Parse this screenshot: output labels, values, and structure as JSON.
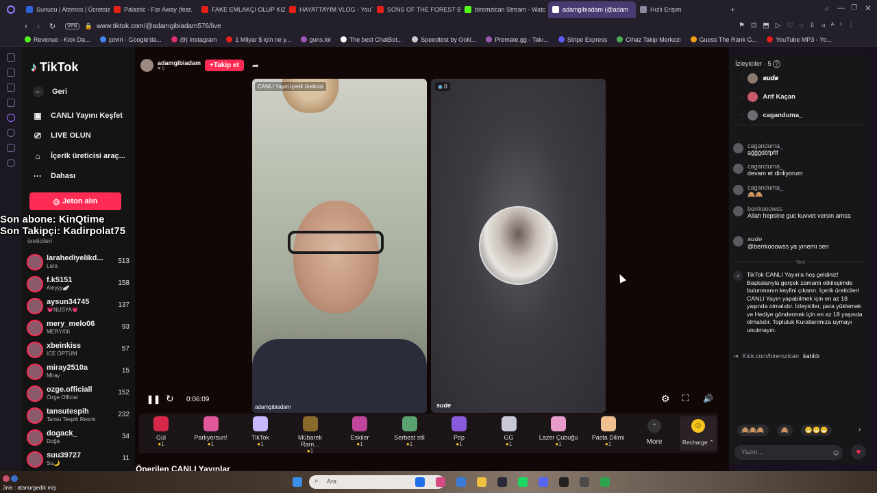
{
  "browser": {
    "tabs": [
      {
        "label": "Sunucu | Aternos | Ücretsiz",
        "color": "#2b62d6"
      },
      {
        "label": "Palastic - Far Away (feat.",
        "color": "#e62117"
      },
      {
        "label": "FAKE EMLAKÇI OLUP KIZ",
        "color": "#e62117"
      },
      {
        "label": "HAYATTAYIM VLOG - YouT",
        "color": "#e62117"
      },
      {
        "label": "SONS OF THE FOREST BİR",
        "color": "#e62117"
      },
      {
        "label": "biremzican Stream - Watc",
        "color": "#53fc18"
      },
      {
        "label": "adamgibiadam (@adam",
        "color": "#ffffff"
      },
      {
        "label": "Hızlı Erişim",
        "color": "#8a8aa0"
      }
    ],
    "url": "www.tiktok.com/@adamgibiadam576/live",
    "vpn": "VPN",
    "bookmarks": [
      {
        "label": "Revenue - Kick Da...",
        "color": "#53fc18"
      },
      {
        "label": "çeviri - Google'da...",
        "color": "#4285f4"
      },
      {
        "label": "(9) Instagram",
        "color": "#e1306c"
      },
      {
        "label": "1 Milyar $ için ne y...",
        "color": "#e62117"
      },
      {
        "label": "guns.lol",
        "color": "#9b59b6"
      },
      {
        "label": "The best ChatBot...",
        "color": "#ffffff"
      },
      {
        "label": "Speedtest by Ookl...",
        "color": "#cccccc"
      },
      {
        "label": "Premate.gg - Takı...",
        "color": "#9b59b6"
      },
      {
        "label": "Stripe Express",
        "color": "#635bff"
      },
      {
        "label": "Cihaz Takip Merkezi",
        "color": "#4caf50"
      },
      {
        "label": "Guess The Rank G...",
        "color": "#f39c12"
      },
      {
        "label": "YouTube MP3 - Yo...",
        "color": "#e62117"
      }
    ]
  },
  "sidebar": {
    "logo": "TikTok",
    "nav": [
      {
        "label": "Geri",
        "icon": "back-arrow-icon"
      },
      {
        "label": "CANLI Yayını Keşfet",
        "icon": "live-tv-icon"
      },
      {
        "label": "LIVE OLUN",
        "icon": "camera-icon"
      },
      {
        "label": "İçerik üreticisi araç...",
        "icon": "home-icon"
      },
      {
        "label": "Dahası",
        "icon": "more-icon"
      }
    ],
    "jeton": "Jeton alın",
    "section_label": "üreticileri",
    "creators": [
      {
        "name": "larahediyelikd...",
        "sub": "Lara",
        "count": "513"
      },
      {
        "name": "f.k5151",
        "sub": "Aleyyy🪽",
        "count": "158"
      },
      {
        "name": "aysun34745",
        "sub": "💗NUSYA💗",
        "count": "137"
      },
      {
        "name": "mery_melo06",
        "sub": "MERY/06",
        "count": "93"
      },
      {
        "name": "xbeinkiss",
        "sub": "ICE ÖPTÜM",
        "count": "57"
      },
      {
        "name": "miray2510a",
        "sub": "Miray",
        "count": "15"
      },
      {
        "name": "ozge.officiall",
        "sub": "Özge Official",
        "count": "152"
      },
      {
        "name": "tansutespih",
        "sub": "Tansu Tespih Resmi",
        "count": "232"
      },
      {
        "name": "dogack_",
        "sub": "Doğa",
        "count": "34"
      },
      {
        "name": "suu39727",
        "sub": "Su🌙",
        "count": "11"
      }
    ]
  },
  "overlay": {
    "line1": "Son abone: KinQtime",
    "line2": "Son Takipçi: Kadirpolat75"
  },
  "stream": {
    "host": "adamgibiadam",
    "host_likes": "0",
    "follow": "+Takip et",
    "left_badge": "CANLI Yayın içerik üreticisi",
    "left_name": "adamgibiadam",
    "right_badge": "0",
    "right_name": "sude",
    "time": "0:06:09"
  },
  "gifts": [
    {
      "name": "Gül",
      "coin": "1",
      "color": "#d6284a"
    },
    {
      "name": "Parlıyorsun!",
      "coin": "1",
      "color": "#e0589a"
    },
    {
      "name": "TikTok",
      "coin": "1",
      "color": "#c9b8ff"
    },
    {
      "name": "Mübarek Ram...",
      "coin": "1",
      "color": "#8a6a2c"
    },
    {
      "name": "Eskiler",
      "coin": "1",
      "color": "#c0459a"
    },
    {
      "name": "Serbest stil",
      "coin": "1",
      "color": "#5aa070"
    },
    {
      "name": "Pop",
      "coin": "1",
      "color": "#8a5adc"
    },
    {
      "name": "GG",
      "coin": "1",
      "color": "#c8c8d8"
    },
    {
      "name": "Lazer Çubuğu",
      "coin": "1",
      "color": "#e89acb"
    },
    {
      "name": "Pasta Dilimi",
      "coin": "1",
      "color": "#f0c090"
    }
  ],
  "gift_more": "More",
  "recharge": "Recharge",
  "suggested": "Önerilen CANLI Yayınlar",
  "right": {
    "viewers_title": "İzleyiciler · 5",
    "viewers": [
      "𝒔𝒖𝒅𝒆",
      "Arif Kaçan",
      "caganduma_"
    ],
    "chat": [
      {
        "user": "caganduma_",
        "msg": "ağğğdöfpflf"
      },
      {
        "user": "caganduma_",
        "msg": "devam et dinliyorum"
      },
      {
        "user": "caganduma_",
        "msg": "🙈🙈"
      },
      {
        "user": "berrkooowss",
        "msg": "Allah hepsine guc kuvvet versin amca"
      },
      {
        "user": "𝒔𝒖𝒅𝒆",
        "msg": "@berrkooowss ya yınemı sen"
      }
    ],
    "new_label": "Yeni",
    "welcome": "TikTok CANLI Yayın'a hoş geldiniz! Başkalarıyla gerçek zamanlı etkileşimde bulunmanın keyfini çıkarın. İçerik üreticileri CANLI Yayın yapabilmek için en az 18 yaşında olmalıdır. İzleyiciler, para yüklemek ve Hediye göndermek için en az 18 yaşında olmalıdır. Topluluk Kurallarımıza uymayı unutmayın.",
    "joined_user": "Kick.com/biremzican",
    "joined_text": "katıldı",
    "quick": [
      "🙈🙈🙈",
      "🙈",
      "😁😁😁"
    ],
    "input_placeholder": "Yazın..."
  },
  "taskbar": {
    "search": "Ara",
    "notif": "3nis : atanurgedik miş"
  }
}
